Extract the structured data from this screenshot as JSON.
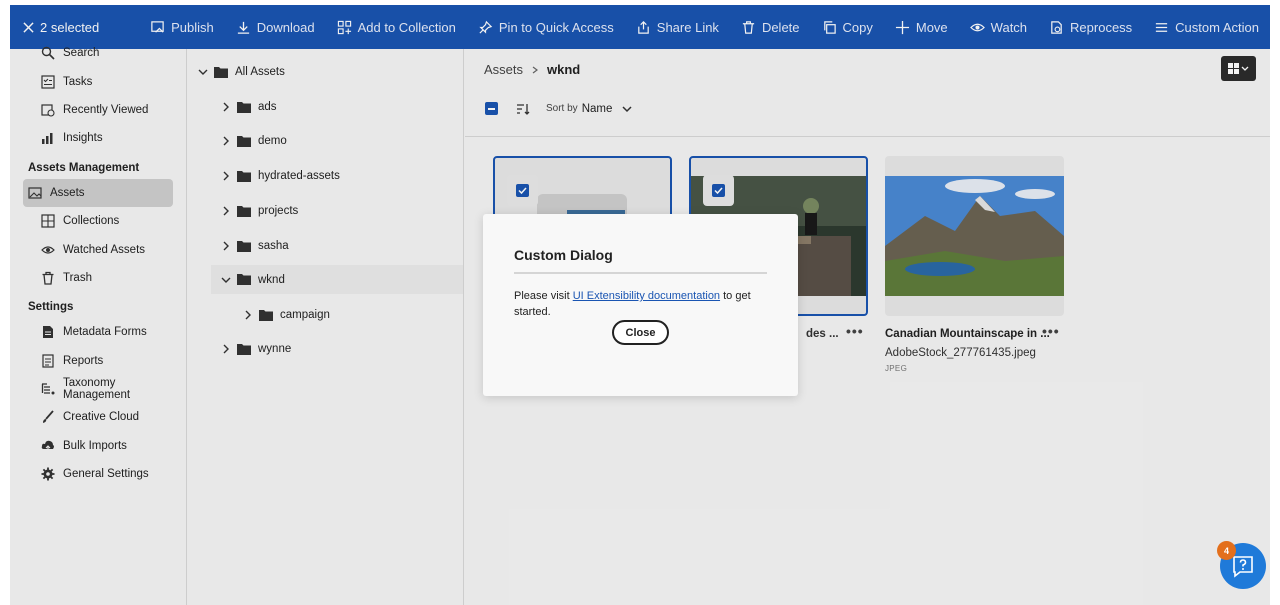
{
  "actionbar": {
    "selected_label": "2 selected",
    "actions": [
      {
        "label": "Publish",
        "icon": "publish-icon"
      },
      {
        "label": "Download",
        "icon": "download-icon"
      },
      {
        "label": "Add to Collection",
        "icon": "add-collection-icon"
      },
      {
        "label": "Pin to Quick Access",
        "icon": "pin-icon"
      },
      {
        "label": "Share Link",
        "icon": "share-icon"
      },
      {
        "label": "Delete",
        "icon": "trash-icon"
      },
      {
        "label": "Copy",
        "icon": "copy-icon"
      },
      {
        "label": "Move",
        "icon": "move-icon"
      },
      {
        "label": "Watch",
        "icon": "eye-icon"
      },
      {
        "label": "Reprocess",
        "icon": "reprocess-icon"
      },
      {
        "label": "Custom Action",
        "icon": "list-icon"
      }
    ]
  },
  "sidebar": {
    "top_items": [
      "Search",
      "Tasks",
      "Recently Viewed",
      "Insights"
    ],
    "assets_heading": "Assets Management",
    "assets_items": [
      "Assets",
      "Collections",
      "Watched Assets",
      "Trash"
    ],
    "settings_heading": "Settings",
    "settings_items": [
      "Metadata Forms",
      "Reports",
      "Taxonomy Management",
      "Creative Cloud",
      "Bulk Imports",
      "General Settings"
    ]
  },
  "tree": {
    "root": "All Assets",
    "folders": [
      "ads",
      "demo",
      "hydrated-assets",
      "projects",
      "sasha",
      "wknd",
      "wynne"
    ],
    "subfolder": "campaign"
  },
  "content": {
    "breadcrumb_root": "Assets",
    "breadcrumb_current": "wknd",
    "sort_label": "Sort by",
    "sort_value": "Name",
    "cards": [
      {
        "title": "",
        "sub": "",
        "type": ""
      },
      {
        "title": "des ...",
        "sub": "",
        "type": ""
      },
      {
        "title": "Canadian Mountainscape in ...",
        "sub": "AdobeStock_277761435.jpeg",
        "type": "JPEG"
      }
    ]
  },
  "dialog": {
    "title": "Custom Dialog",
    "body_before": "Please visit ",
    "link": "UI Extensibility documentation",
    "body_after": " to get started.",
    "close_label": "Close"
  },
  "help": {
    "badge_count": "4"
  }
}
